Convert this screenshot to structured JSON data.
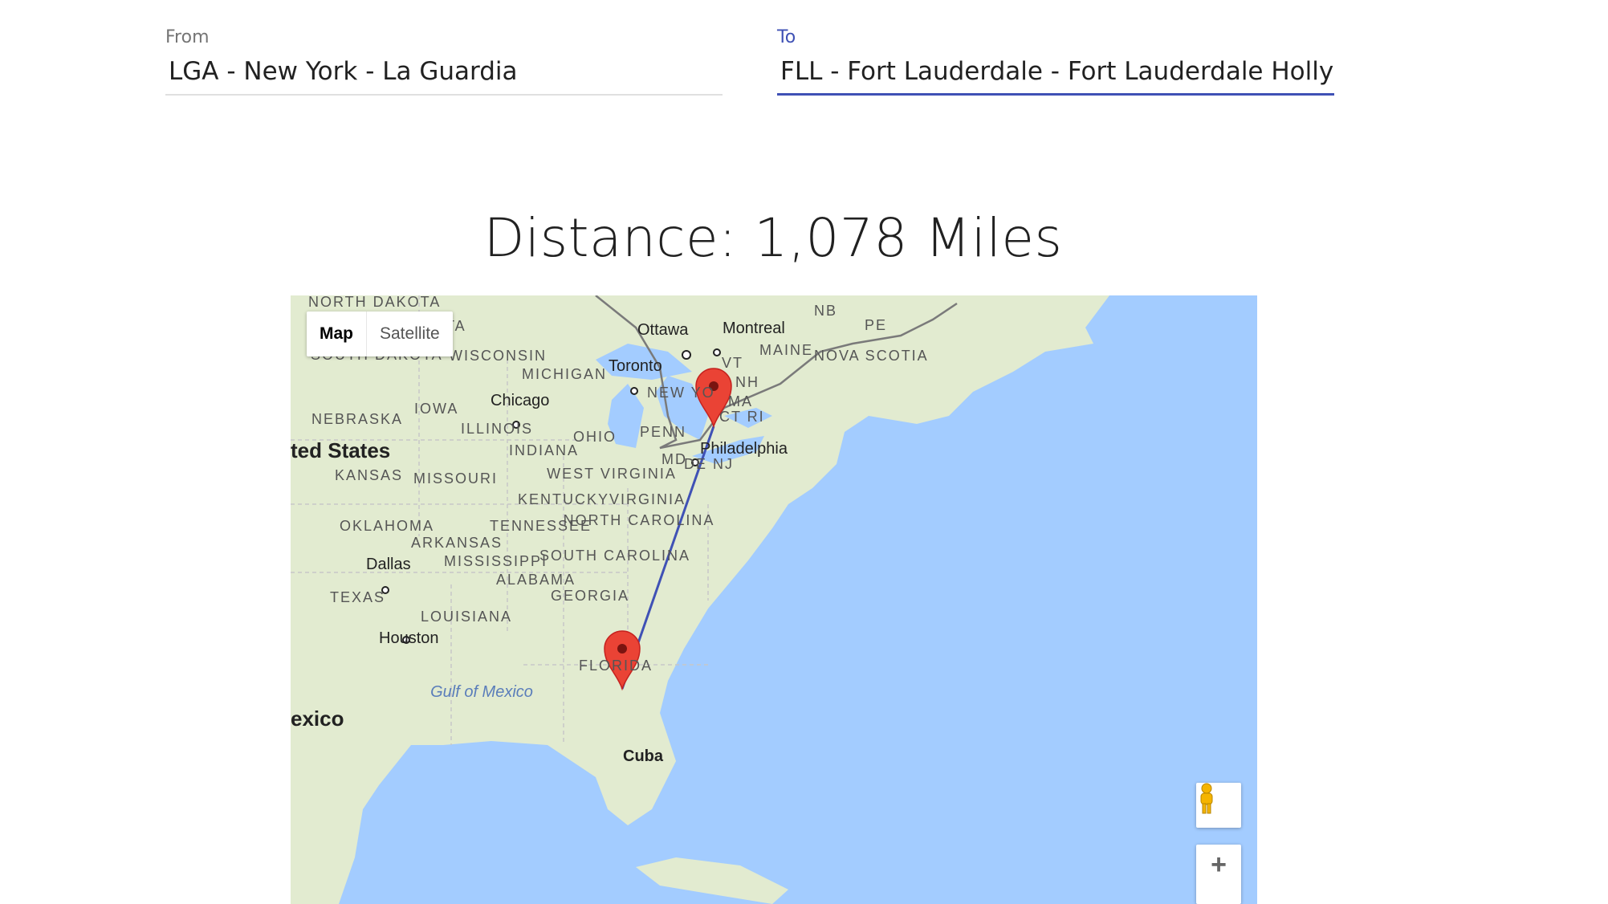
{
  "form": {
    "from": {
      "label": "From",
      "value": "LGA - New York - La Guardia"
    },
    "to": {
      "label": "To",
      "value": "FLL - Fort Lauderdale - Fort Lauderdale Hollywood"
    }
  },
  "distance_text": "Distance: 1,078 Miles",
  "map": {
    "type_controls": {
      "map": "Map",
      "satellite": "Satellite"
    },
    "zoom_in_label": "+",
    "route_color": "#3f51b5",
    "marker_color": "#ea4335",
    "water_color": "#a3ccff",
    "land_color": "#e2ebd0",
    "labels": {
      "north_dakota": "NORTH DAKOTA",
      "minnesota": "SOTA",
      "south_dakota": "SOUTH DAKOTA",
      "wisconsin": "WISCONSIN",
      "michigan": "MICHIGAN",
      "ottawa": "Ottawa",
      "montreal": "Montreal",
      "nb": "NB",
      "pe": "PE",
      "maine": "MAINE",
      "nova_scotia": "NOVA SCOTIA",
      "toronto": "Toronto",
      "vt": "VT",
      "nh": "NH",
      "new_york": "NEW YO",
      "ma": "MA",
      "ct_ri": "CT RI",
      "chicago": "Chicago",
      "iowa": "IOWA",
      "nebraska": "NEBRASKA",
      "illinois": "ILLINOIS",
      "ohio": "OHIO",
      "penn": "PENN",
      "philadelphia": "Philadelphia",
      "united_states": "ted States",
      "indiana": "INDIANA",
      "md": "MD",
      "de_nj": "DE NJ",
      "kansas": "KANSAS",
      "missouri": "MISSOURI",
      "west_virginia": "WEST VIRGINIA",
      "kentucky": "KENTUCKY",
      "virginia": "VIRGINIA",
      "oklahoma": "OKLAHOMA",
      "tennessee": "TENNESSEE",
      "north_carolina": "NORTH CAROLINA",
      "arkansas": "ARKANSAS",
      "mississippi": "MISSISSIPPI",
      "south_carolina": "SOUTH CAROLINA",
      "dallas": "Dallas",
      "alabama": "ALABAMA",
      "texas": "TEXAS",
      "georgia": "GEORGIA",
      "louisiana": "LOUISIANA",
      "houston": "Houston",
      "florida": "FLORIDA",
      "gulf_of_mexico": "Gulf of Mexico",
      "mexico": "exico",
      "cuba": "Cuba"
    }
  }
}
